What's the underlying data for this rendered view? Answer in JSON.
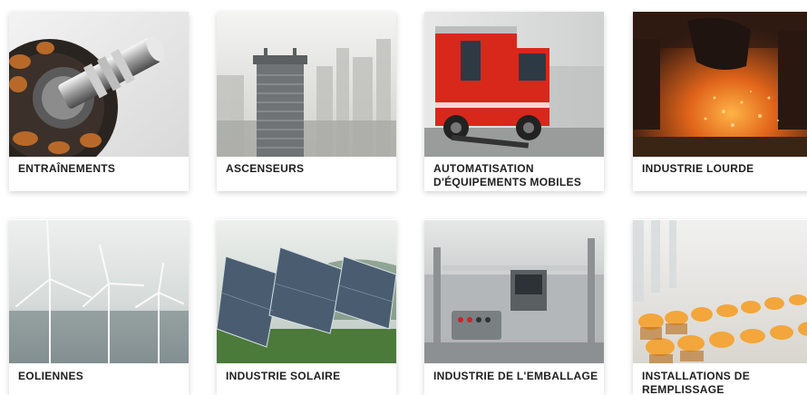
{
  "cards": [
    {
      "label": "ENTRAÎNEMENTS",
      "image_subject": "electric-motor-image"
    },
    {
      "label": "ASCENSEURS",
      "image_subject": "skyscraper-image"
    },
    {
      "label": "AUTOMATISATION D'ÉQUIPEMENTS MOBILES",
      "image_subject": "fire-truck-image"
    },
    {
      "label": "INDUSTRIE LOURDE",
      "image_subject": "steel-foundry-image"
    },
    {
      "label": "EOLIENNES",
      "image_subject": "wind-turbines-image"
    },
    {
      "label": "INDUSTRIE SOLAIRE",
      "image_subject": "solar-panels-image"
    },
    {
      "label": "INDUSTRIE DE L'EMBALLAGE",
      "image_subject": "packaging-machine-image"
    },
    {
      "label": "INSTALLATIONS DE REMPLISSAGE",
      "image_subject": "bottle-filling-image"
    }
  ],
  "colors": {
    "label_text": "#1e1e1e",
    "card_background": "#ffffff",
    "fire_truck_red": "#d8281c",
    "furnace_orange": "#e0641a"
  }
}
